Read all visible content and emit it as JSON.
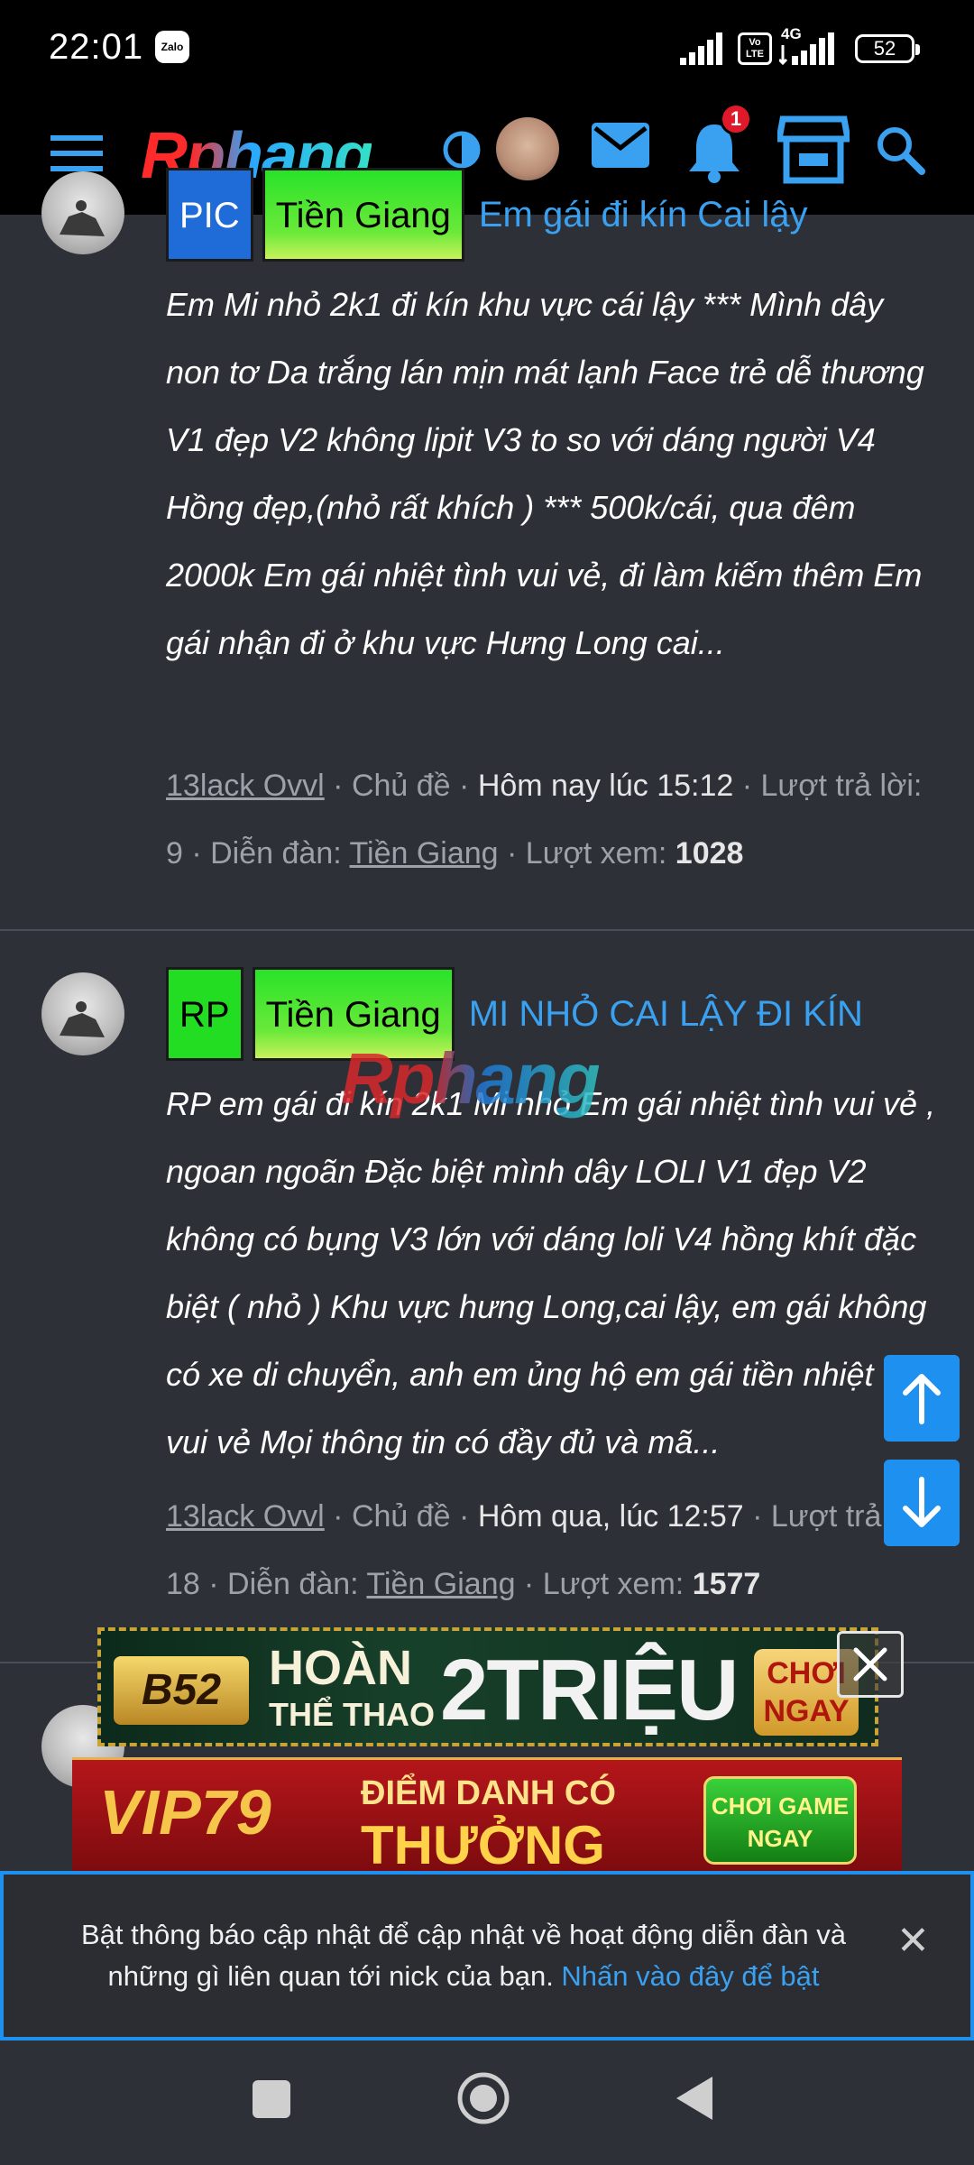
{
  "status_bar": {
    "time": "22:01",
    "notif_app": "Zalo",
    "volte": "Vo LTE",
    "network": "4G",
    "battery": "52"
  },
  "header": {
    "logo": "Rphang",
    "notification_count": "1"
  },
  "threads": [
    {
      "prefix_1": "PIC",
      "prefix_2": "Tiền Giang",
      "title": "Em gái đi kín Cai lậy",
      "excerpt": "Em Mi nhỏ 2k1 đi kín khu vực cái lậy *** Mình dây non tơ Da trắng lán mịn mát lạnh Face trẻ dễ thương V1 đẹp V2 không lipit V3 to so với dáng người V4 Hồng đẹp,(nhỏ rất khích ) *** 500k/cái, qua đêm 2000k Em gái nhiệt tình vui vẻ, đi làm kiếm thêm Em gái nhận đi ở khu vực Hưng Long cai...",
      "author": "13lack Ovvl",
      "sep_topic": " · Chủ đề · ",
      "time": "Hôm nay lúc 15:12",
      "replies_label": " · Lượt trả lời: 9 · Diễn đàn: ",
      "forum": "Tiền Giang",
      "views_label": " · Lượt xem: ",
      "views": "1028"
    },
    {
      "prefix_1": "RP",
      "prefix_2": "Tiền Giang",
      "title": "MI NHỎ CAI LẬY ĐI KÍN",
      "excerpt": "RP em gái đi kín 2k1 Mi nhỏ Em gái nhiệt tình vui vẻ , ngoan ngoãn Đặc biệt mình dây LOLI V1 đẹp V2 không có bụng V3 lớn với dáng loli V4 hồng khít đặc biệt ( nhỏ ) Khu vực hưng Long,cai lậy, em gái không có xe di chuyển, anh em ủng hộ em gái tiền nhiệt tình vui vẻ Mọi thông tin có đầy đủ và mã...",
      "author": "13lack Ovvl",
      "sep_topic": " · Chủ đề · ",
      "time": "Hôm qua, lúc 12:57",
      "replies_label": " · Lượt trả lời: 18 · Diễn đàn: ",
      "forum": "Tiền Giang",
      "views_label": " · Lượt xem: ",
      "views": "1577"
    }
  ],
  "watermark": "Rphang",
  "ads": {
    "ad1": {
      "brand": "B52",
      "line1": "HOÀN",
      "line2": "THỂ THAO",
      "amount": "2TRIỆU",
      "cta": "CHƠI NGAY"
    },
    "ad2": {
      "brand": "VIP79",
      "line1": "ĐIỂM DANH CÓ",
      "line2": "THƯỞNG",
      "cta": "CHƠI GAME NGAY"
    }
  },
  "notice": {
    "text": "Bật thông báo cập nhật để cập nhật về hoạt động diễn đàn và những gì liên quan tới nick của bạn. ",
    "link": "Nhấn vào đây để bật",
    "close": "✕"
  },
  "colors": {
    "accent": "#1e90f0",
    "link": "#3aa0f0",
    "background": "#2e3038",
    "badge": "#e0192a"
  }
}
